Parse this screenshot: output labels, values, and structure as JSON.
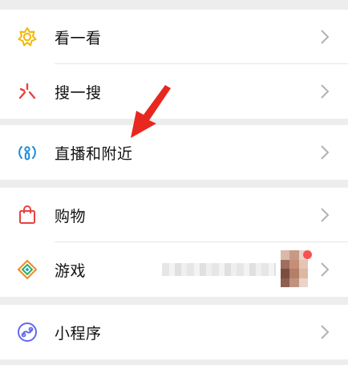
{
  "colors": {
    "background": "#ededed",
    "card": "#ffffff",
    "text": "#111111",
    "chevron": "#b2b2b2",
    "annotation_arrow": "#e8271f",
    "badge": "#fa5151"
  },
  "menu": {
    "group1": [
      {
        "id": "top-stories",
        "label": "看一看",
        "icon": "top-stories-icon"
      },
      {
        "id": "search",
        "label": "搜一搜",
        "icon": "search-spark-icon"
      }
    ],
    "group2": [
      {
        "id": "live-nearby",
        "label": "直播和附近",
        "icon": "live-nearby-icon"
      }
    ],
    "group3": [
      {
        "id": "shopping",
        "label": "购物",
        "icon": "shopping-bag-icon"
      },
      {
        "id": "games",
        "label": "游戏",
        "icon": "game-diamond-icon",
        "badge": true
      }
    ],
    "group4": [
      {
        "id": "mini-programs",
        "label": "小程序",
        "icon": "mini-program-icon"
      }
    ]
  }
}
